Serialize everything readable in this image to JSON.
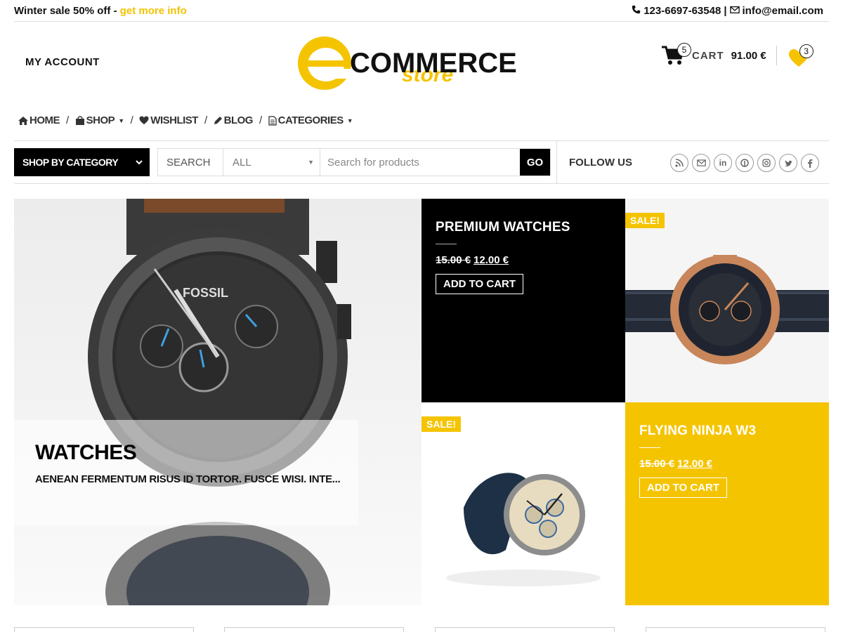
{
  "topbar": {
    "promo_text": "Winter sale 50% off - ",
    "promo_link": "get more info",
    "phone": "123-6697-63548",
    "separator": "|",
    "email": "info@email.com",
    "phone_icon": "phone-icon",
    "email_icon": "envelope-icon"
  },
  "header": {
    "my_account": "MY ACCOUNT",
    "logo_letter": "e",
    "logo_word": "COMMERCE",
    "logo_sub": "store",
    "cart_count": "5",
    "cart_label": "CART",
    "cart_total": "91.00 €",
    "wishlist_count": "3"
  },
  "nav": {
    "items": [
      {
        "label": "HOME",
        "icon": "home-icon"
      },
      {
        "label": "SHOP",
        "icon": "shopping-bag-icon",
        "dropdown": true
      },
      {
        "label": "WISHLIST",
        "icon": "heart-icon"
      },
      {
        "label": "BLOG",
        "icon": "pencil-icon"
      },
      {
        "label": "CATEGORIES",
        "icon": "document-icon",
        "dropdown": true
      }
    ],
    "separator": "/"
  },
  "search": {
    "shop_by_category": "SHOP BY CATEGORY",
    "label": "SEARCH",
    "category_selected": "ALL",
    "placeholder": "Search for products",
    "go": "GO",
    "follow_us": "FOLLOW US"
  },
  "socials": [
    "rss-icon",
    "envelope-icon",
    "linkedin-icon",
    "pinterest-icon",
    "instagram-icon",
    "twitter-icon",
    "facebook-icon"
  ],
  "hero": {
    "title": "WATCHES",
    "description": "AENEAN FERMENTUM RISUS ID TORTOR. FUSCE WISI. INTE..."
  },
  "tiles": {
    "premium": {
      "title": "PREMIUM WATCHES",
      "old_price": "15.00 €",
      "new_price": "12.00 €",
      "button": "ADD TO CART"
    },
    "ninja": {
      "title": "FLYING NINJA W3",
      "old_price": "15.00 €",
      "new_price": "12.00 €",
      "button": "ADD TO CART"
    },
    "sale_badge": "SALE!",
    "dial_brand": "FOSSIL"
  },
  "colors": {
    "accent": "#f5c400",
    "dark": "#000000"
  }
}
